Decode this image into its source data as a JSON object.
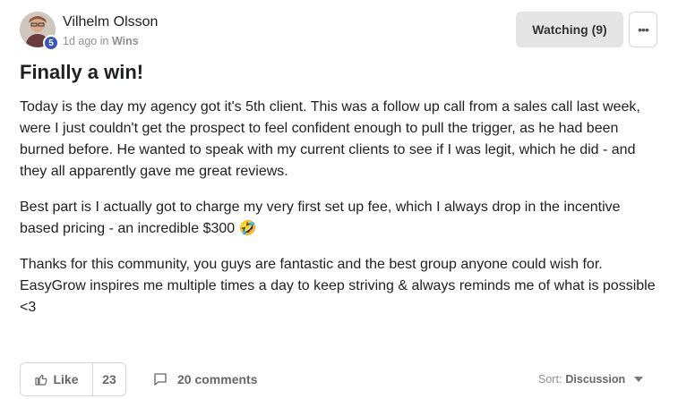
{
  "author": {
    "name": "Vilhelm Olsson",
    "level": "5",
    "time": "1d ago",
    "in_word": "in",
    "category": "Wins"
  },
  "actions": {
    "watching_label": "Watching (9)",
    "more_label": "•••"
  },
  "post": {
    "title": "Finally a win!",
    "paragraphs": [
      "Today is the day my agency got it's 5th client. This was a follow up call from a sales call last week, were I just couldn't get the prospect to feel confident enough to pull the trigger, as he had been burned before. He wanted to speak with my current clients to see if I was legit, which he did - and they all apparently gave me great reviews.",
      "Best part is I actually got to charge my very first set up fee, which I always drop in the incentive based pricing - an incredible $300 🤣",
      "Thanks for this community, you guys are fantastic and the best group anyone could wish for. EasyGrow inspires me multiple times a day to keep striving & always reminds me of what is possible <3"
    ]
  },
  "footer": {
    "like_label": "Like",
    "like_count": "23",
    "comments_label": "20 comments",
    "sort_label": "Sort:",
    "sort_value": "Discussion"
  },
  "icons": {
    "avatar": "user-avatar",
    "more": "more-dots-icon",
    "like": "thumbs-up-icon",
    "comment": "comment-bubble-icon",
    "caret": "caret-down-icon"
  }
}
